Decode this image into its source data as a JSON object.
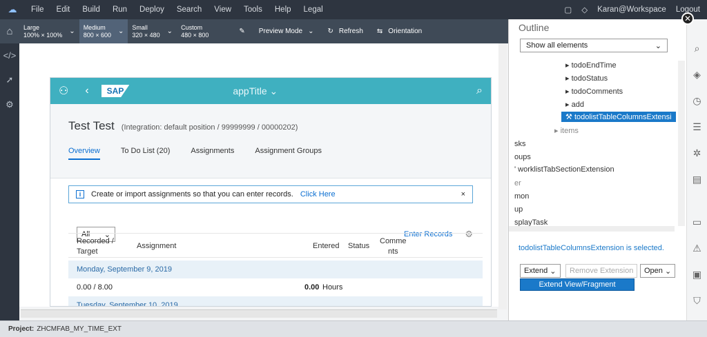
{
  "menubar": {
    "items": [
      "File",
      "Edit",
      "Build",
      "Run",
      "Deploy",
      "Search",
      "View",
      "Tools",
      "Help",
      "Legal"
    ],
    "user": "Karan@Workspace",
    "logout": "Logout"
  },
  "toolbar": {
    "devices": [
      {
        "label": "Large",
        "size": "100% × 100%"
      },
      {
        "label": "Medium",
        "size": "800 × 600"
      },
      {
        "label": "Small",
        "size": "320 × 480"
      },
      {
        "label": "Custom",
        "size": "480 × 800"
      }
    ],
    "preview_mode": "Preview Mode",
    "refresh": "Refresh",
    "orientation": "Orientation"
  },
  "app": {
    "title": "appTitle",
    "logo": "SAP",
    "object_title": "Test Test",
    "object_subtitle": "(Integration: default position / 99999999 / 00000202)",
    "tabs": [
      "Overview",
      "To Do List (20)",
      "Assignments",
      "Assignment Groups"
    ],
    "message": "Create or import assignments so that you can enter records.",
    "message_link": "Click Here",
    "select_value": "All",
    "enter_records": "Enter Records",
    "columns": {
      "recorded": "Recorded /",
      "target": "Target",
      "assignment": "Assignment",
      "entered": "Entered",
      "status": "Status",
      "comments1": "Comme",
      "comments2": "nts"
    },
    "rows": {
      "group1": "Monday, September 9, 2019",
      "value1": "0.00 / 8.00",
      "hours_num": "0.00",
      "hours_unit": "Hours",
      "group2": "Tuesday, September 10, 2019"
    }
  },
  "outline": {
    "title": "Outline",
    "filter": "Show all elements",
    "nodes": [
      "todoEndTime",
      "todoStatus",
      "todoComments",
      "add",
      "todolistTableColumnsExtensi",
      "items",
      "sks",
      "oups",
      "worklistTabSectionExtension",
      "er",
      "mon",
      "up",
      "splayTask"
    ],
    "selected_info": "todolistTableColumnsExtension is selected.",
    "extend": "Extend",
    "remove": "Remove Extension",
    "open": "Open",
    "menu_item": "Extend View/Fragment"
  },
  "status": {
    "label": "Project:",
    "project": "ZHCMFAB_MY_TIME_EXT"
  }
}
